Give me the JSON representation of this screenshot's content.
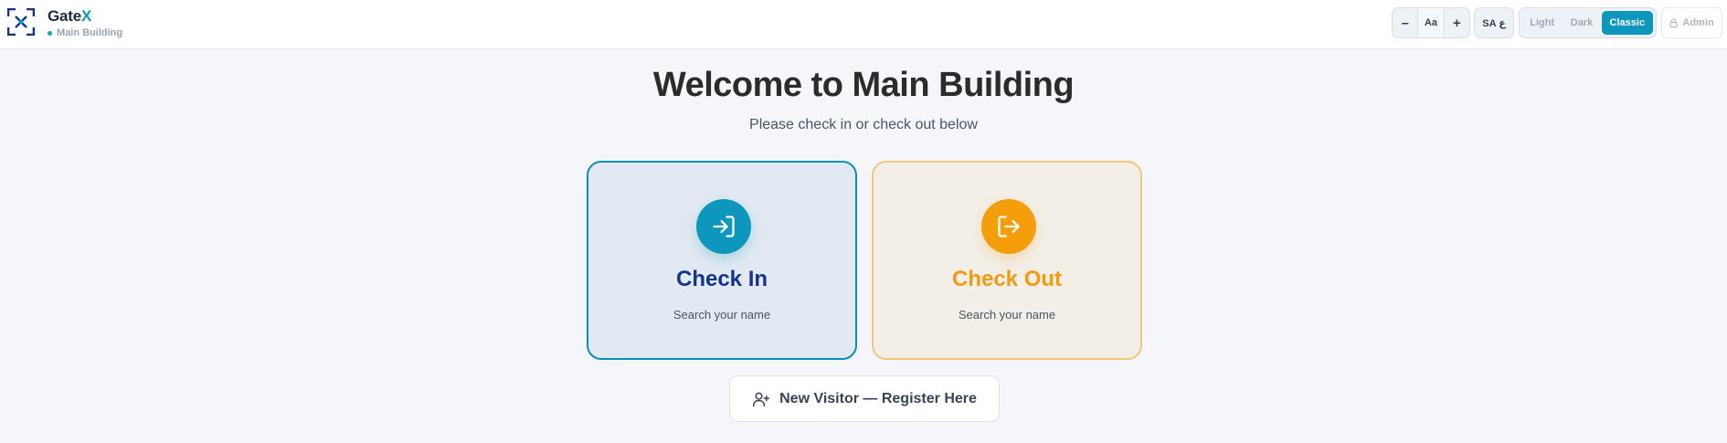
{
  "header": {
    "brand_name_main": "Gate",
    "brand_name_accent": "X",
    "location": "Main Building",
    "font_controls": {
      "decrease": "–",
      "reset": "Aa",
      "increase": "+"
    },
    "language_toggle": "SA ع",
    "themes": [
      "Light",
      "Dark",
      "Classic"
    ],
    "active_theme": "Classic",
    "admin_label": "Admin"
  },
  "main": {
    "title": "Welcome to Main Building",
    "subtitle": "Please check in or check out below",
    "check_in": {
      "title": "Check In",
      "subtitle": "Search your name"
    },
    "check_out": {
      "title": "Check Out",
      "subtitle": "Search your name"
    },
    "register_label": "New Visitor — Register Here"
  },
  "colors": {
    "accent": "#0d97bd",
    "check_in_title": "#12348f",
    "check_out_accent": "#f59e0b",
    "background": "#f5f6f9"
  },
  "icons": [
    "gatex-logo-icon",
    "lock-icon",
    "sign-in-icon",
    "sign-out-icon",
    "user-plus-icon"
  ]
}
